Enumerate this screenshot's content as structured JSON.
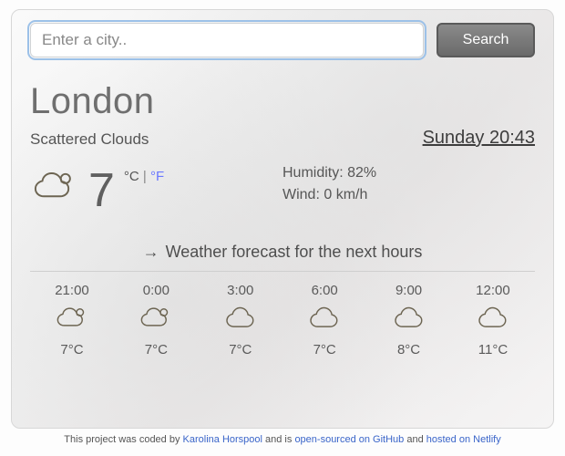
{
  "search": {
    "placeholder": "Enter a city..",
    "button": "Search"
  },
  "city": "London",
  "description": "Scattered Clouds",
  "datetime": "Sunday 20:43",
  "current": {
    "temp": "7",
    "unit_c_label": "°C",
    "unit_sep": " | ",
    "unit_f_label": "°F",
    "icon": "partly-cloudy"
  },
  "details": {
    "humidity_label": "Humidity: ",
    "humidity_value": "82%",
    "wind_label": "Wind: ",
    "wind_value": "0 km/h"
  },
  "forecast_title": "Weather forecast for the next hours",
  "forecast": [
    {
      "time": "21:00",
      "icon": "partly-cloudy",
      "temp": "7°C"
    },
    {
      "time": "0:00",
      "icon": "partly-cloudy",
      "temp": "7°C"
    },
    {
      "time": "3:00",
      "icon": "cloud",
      "temp": "7°C"
    },
    {
      "time": "6:00",
      "icon": "cloud",
      "temp": "7°C"
    },
    {
      "time": "9:00",
      "icon": "cloud",
      "temp": "8°C"
    },
    {
      "time": "12:00",
      "icon": "cloud",
      "temp": "11°C"
    }
  ],
  "footer": {
    "t1": "This project was coded by ",
    "author": "Karolina Horspool",
    "t2": " and is ",
    "link1": "open-sourced on GitHub",
    "t3": " and ",
    "link2": "hosted on Netlify"
  }
}
